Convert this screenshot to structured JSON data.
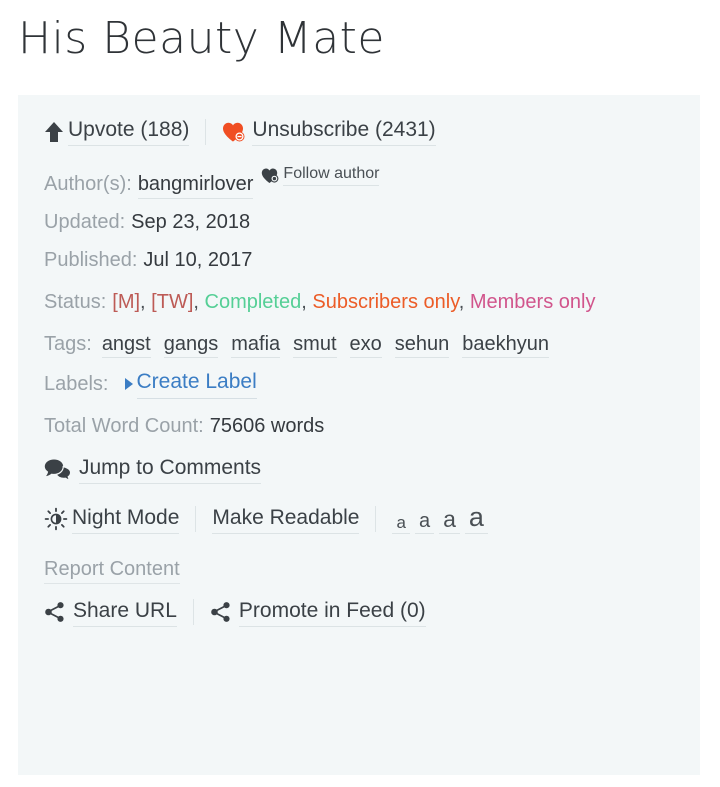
{
  "story": {
    "title": "His Beauty Mate"
  },
  "actions": {
    "upvote": {
      "label": "Upvote (188)",
      "icon": "arrow-up-icon"
    },
    "unsubscribe": {
      "label": "Unsubscribe (2431)",
      "icon": "heart-minus-icon",
      "icon_color": "#f04e23"
    }
  },
  "meta": {
    "author_label": "Author(s):",
    "author_name": "bangmirlover",
    "follow_author": "Follow author",
    "updated_label": "Updated:",
    "updated_value": "Sep 23, 2018",
    "published_label": "Published:",
    "published_value": "Jul 10, 2017"
  },
  "status": {
    "label": "Status:",
    "items": [
      {
        "text": "[M]",
        "color": "#bd5b56"
      },
      {
        "text": "[TW]",
        "color": "#bd5b56"
      },
      {
        "text": "Completed",
        "color": "#55cf96"
      },
      {
        "text": "Subscribers only",
        "color": "#ec5c27"
      },
      {
        "text": "Members only",
        "color": "#d1558c"
      }
    ],
    "separator": ", "
  },
  "tags": {
    "label": "Tags:",
    "items": [
      "angst",
      "gangs",
      "mafia",
      "smut",
      "exo",
      "sehun",
      "baekhyun"
    ]
  },
  "labels": {
    "label": "Labels:",
    "create_label": "Create Label",
    "create_label_color": "#3b7dc4"
  },
  "word_count": {
    "label": "Total Word Count:",
    "value": "75606 words"
  },
  "comments": {
    "label": "Jump to Comments",
    "icon": "speech-bubbles-icon"
  },
  "reading": {
    "night_mode": "Night Mode",
    "night_mode_icon": "brightness-sun-icon",
    "make_readable": "Make Readable",
    "font_sizes": [
      "a",
      "a",
      "a",
      "a"
    ]
  },
  "report": {
    "label": "Report Content"
  },
  "share": {
    "share_url": "Share URL",
    "promote": "Promote in Feed (0)",
    "icon": "share-nodes-icon"
  },
  "colors": {
    "panel_bg": "#f3f7f8",
    "page_bg": "#ffffff",
    "muted_text": "#9aa2a8",
    "dark_text": "#353a3f",
    "link_blue": "#3b7dc4",
    "accent_orange": "#f04e23"
  }
}
